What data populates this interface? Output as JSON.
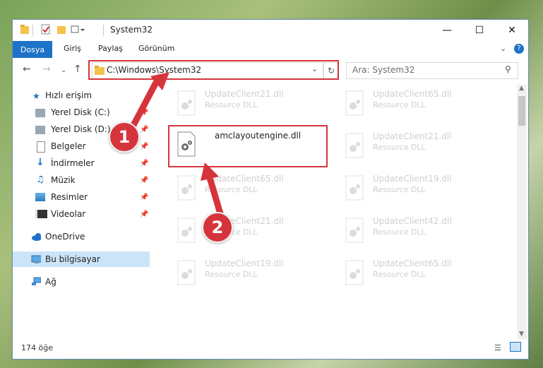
{
  "window": {
    "title": "System32"
  },
  "ribbon": {
    "tabs": [
      "Dosya",
      "Giriş",
      "Paylaş",
      "Görünüm"
    ]
  },
  "nav": {
    "address": "C:\\Windows\\System32",
    "search_placeholder": "Ara: System32"
  },
  "sidebar": {
    "items": [
      {
        "label": "Hızlı erişim",
        "icon": "star-icon"
      },
      {
        "label": "Yerel Disk (C:)",
        "icon": "drive-icon",
        "pinned": true
      },
      {
        "label": "Yerel Disk (D:)",
        "icon": "drive-icon",
        "pinned": true
      },
      {
        "label": "Belgeler",
        "icon": "documents-icon",
        "pinned": true
      },
      {
        "label": "İndirmeler",
        "icon": "download-icon",
        "pinned": true
      },
      {
        "label": "Müzik",
        "icon": "music-icon",
        "pinned": true
      },
      {
        "label": "Resimler",
        "icon": "pictures-icon",
        "pinned": true
      },
      {
        "label": "Videolar",
        "icon": "videos-icon",
        "pinned": true
      },
      {
        "label": "OneDrive",
        "icon": "cloud-icon"
      },
      {
        "label": "Bu bilgisayar",
        "icon": "computer-icon",
        "selected": true
      },
      {
        "label": "Ağ",
        "icon": "network-icon"
      }
    ]
  },
  "files": {
    "highlighted": {
      "name": "amclayoutengine.dll"
    },
    "left": [
      {
        "name": "UpdateClient21.dll",
        "type": "Resource DLL"
      },
      {
        "name": "UpdateClient65.dll",
        "type": "Resource DLL"
      },
      {
        "name": "UpdateClient21.dll",
        "type": "Resource DLL"
      },
      {
        "name": "UpdateClient19.dll",
        "type": "Resource DLL"
      }
    ],
    "right": [
      {
        "name": "UpdateClient65.dll",
        "type": "Resource DLL"
      },
      {
        "name": "UpdateClient21.dll",
        "type": "Resource DLL"
      },
      {
        "name": "UpdateClient19.dll",
        "type": "Resource DLL"
      },
      {
        "name": "UpdateClient42.dll",
        "type": "Resource DLL"
      },
      {
        "name": "UpdateClient65.dll",
        "type": "Resource DLL"
      }
    ]
  },
  "status": {
    "count": "174 öğe"
  },
  "annotations": {
    "step1": "1",
    "step2": "2"
  },
  "colors": {
    "accent": "#1e73c8",
    "highlight": "#d6343c"
  }
}
